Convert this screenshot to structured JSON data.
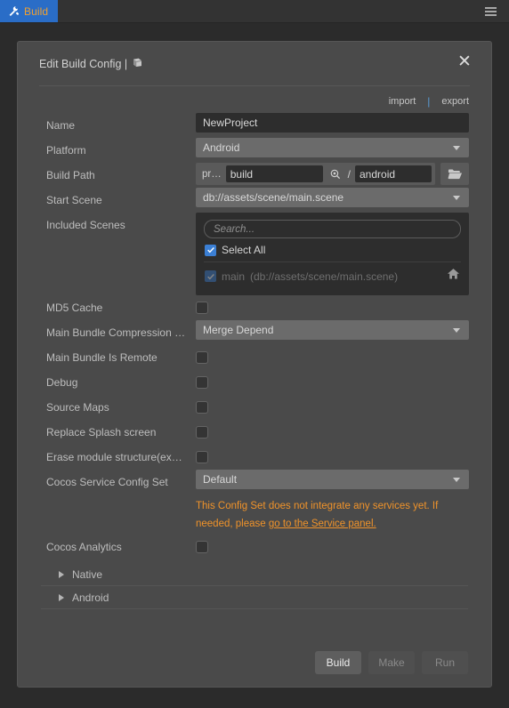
{
  "tabbar": {
    "tab_label": "Build",
    "tab_icon": "hammer-wrench-icon",
    "menu_icon": "hamburger-menu-icon",
    "tab_bg": "#2a6dc7",
    "tab_fg": "#f0a030"
  },
  "dialog": {
    "title": "Edit Build Config |",
    "title_icon": "book-icon",
    "close_label": "✕",
    "import_label": "import",
    "separator": "|",
    "export_label": "export"
  },
  "fields": {
    "name": {
      "label": "Name",
      "value": "NewProject"
    },
    "platform": {
      "label": "Platform",
      "value": "Android"
    },
    "build_path": {
      "label": "Build Path",
      "prefix": "pr…",
      "value": "build",
      "search_icon": "magnifier-icon",
      "slash": "/",
      "sub_value": "android",
      "folder_icon": "folder-open-icon"
    },
    "start_scene": {
      "label": "Start Scene",
      "value": "db://assets/scene/main.scene"
    },
    "included_scenes": {
      "label": "Included Scenes",
      "search_placeholder": "Search...",
      "select_all_label": "Select All",
      "select_all_checked": true,
      "scene_name": "main",
      "scene_path": "(db://assets/scene/main.scene)",
      "scene_checked": true,
      "home_icon": "home-icon"
    },
    "md5_cache": {
      "label": "MD5 Cache",
      "checked": false
    },
    "main_bundle_compression": {
      "label": "Main Bundle Compression …",
      "value": "Merge Depend"
    },
    "main_bundle_is_remote": {
      "label": "Main Bundle Is Remote",
      "checked": false
    },
    "debug": {
      "label": "Debug",
      "checked": false
    },
    "source_maps": {
      "label": "Source Maps",
      "checked": false
    },
    "replace_splash": {
      "label": "Replace Splash screen",
      "checked": false
    },
    "erase_module": {
      "label": "Erase module structure(ex…",
      "checked": false
    },
    "cocos_service_config_set": {
      "label": "Cocos Service Config Set",
      "value": "Default"
    },
    "service_warning": {
      "text_before": "This Config Set does not integrate any services yet. If needed, please ",
      "link_text": "go to the Service panel.",
      "color": "#f0932a"
    },
    "cocos_analytics": {
      "label": "Cocos Analytics",
      "checked": false
    }
  },
  "foldouts": [
    {
      "label": "Native",
      "expanded": false
    },
    {
      "label": "Android",
      "expanded": false
    }
  ],
  "footer": {
    "build_label": "Build",
    "make_label": "Make",
    "run_label": "Run"
  }
}
